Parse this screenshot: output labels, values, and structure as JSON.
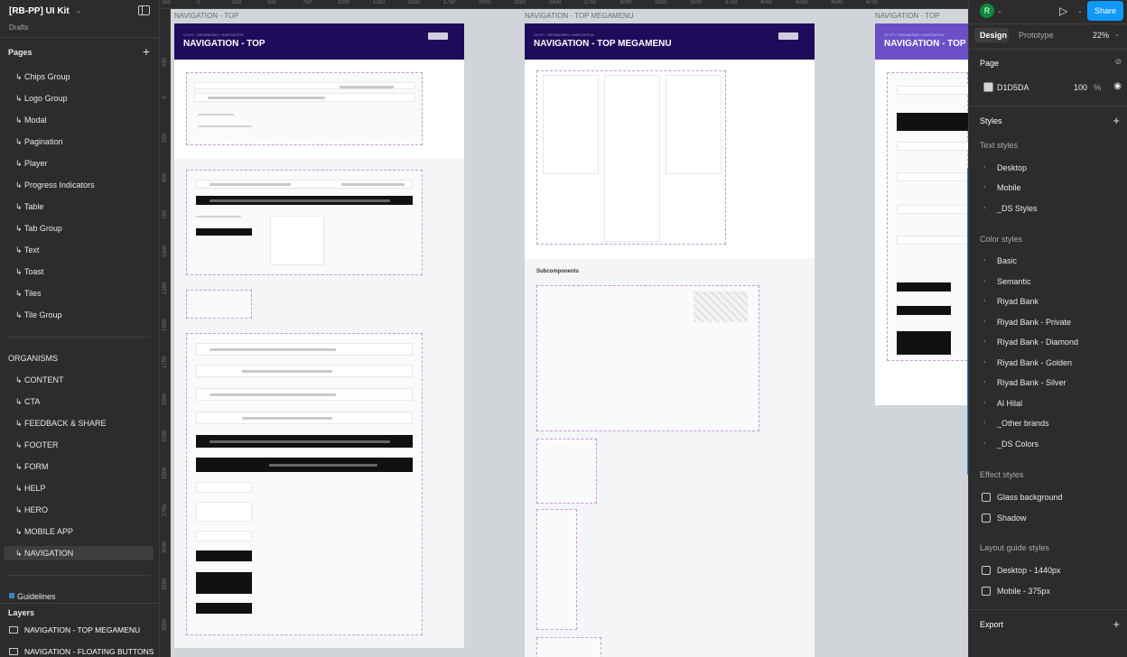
{
  "file": {
    "title": "[RB-PP] UI Kit",
    "location": "Drafts"
  },
  "pages_header": "Pages",
  "pages": [
    "↳ Chips Group",
    "↳ Logo Group",
    "↳ Modal",
    "↳ Pagination",
    "↳ Player",
    "↳ Progress Indicators",
    "↳ Table",
    "↳ Tab Group",
    "↳ Text",
    "↳ Toast",
    "↳ Tiles",
    "↳ Tile Group"
  ],
  "organisms_header": "ORGANISMS",
  "organisms": [
    "↳ CONTENT",
    "↳ CTA",
    "↳ FEEDBACK & SHARE",
    "↳ FOOTER",
    "↳ FORM",
    "↳ HELP",
    "↳ HERO",
    "↳ MOBILE APP",
    "↳ NAVIGATION"
  ],
  "selected_page": "↳ NAVIGATION",
  "guidelines": "Guidelines",
  "layers_header": "Layers",
  "layers": [
    "NAVIGATION - TOP MEGAMENU",
    "NAVIGATION - FLOATING BUTTONS"
  ],
  "ruler": {
    "top": [
      "250",
      "0",
      "250",
      "500",
      "750",
      "1000",
      "1250",
      "1500",
      "1750",
      "2000",
      "2250",
      "2500",
      "2750",
      "3000",
      "3250",
      "3500",
      "3750",
      "4000",
      "4250",
      "4500",
      "4750"
    ],
    "left": [
      "250",
      "0",
      "250",
      "500",
      "750",
      "1000",
      "1250",
      "1500",
      "1750",
      "2000",
      "2250",
      "2500",
      "2750",
      "3000",
      "3250",
      "3500"
    ]
  },
  "canvas": {
    "frame_labels": [
      "NAVIGATION - TOP",
      "NAVIGATION - TOP MEGAMENU",
      "NAVIGATION - TOP"
    ],
    "frame_titles": [
      "NAVIGATION - TOP",
      "NAVIGATION - TOP MEGAMENU",
      "NAVIGATION - TOP"
    ],
    "subcomponents": "Subcomponents"
  },
  "toolbar": {
    "avatar": "R",
    "share": "Share"
  },
  "tabs": [
    "Design",
    "Prototype"
  ],
  "zoom": "22%",
  "page_section": {
    "label": "Page",
    "color": "D1D5DA",
    "opacity": "100",
    "unit": "%"
  },
  "styles_header": "Styles",
  "text_styles": {
    "header": "Text styles",
    "items": [
      "Desktop",
      "Mobile",
      "_DS Styles"
    ]
  },
  "color_styles": {
    "header": "Color styles",
    "items": [
      "Basic",
      "Semantic",
      "Riyad Bank",
      "Riyad Bank - Private",
      "Riyad Bank - Diamond",
      "Riyad Bank - Golden",
      "Riyad Bank - Silver",
      "Al Hilal",
      "_Other brands",
      "_DS Colors"
    ]
  },
  "effect_styles": {
    "header": "Effect styles",
    "items": [
      "Glass background",
      "Shadow"
    ]
  },
  "layout_styles": {
    "header": "Layout guide styles",
    "items": [
      "Desktop - 1440px",
      "Mobile - 375px"
    ]
  },
  "export_label": "Export",
  "colors": {
    "panel": "#2c2c2c",
    "canvas": "#d1d5da",
    "accent": "#0d99ff",
    "header": "#1e0c5a"
  }
}
